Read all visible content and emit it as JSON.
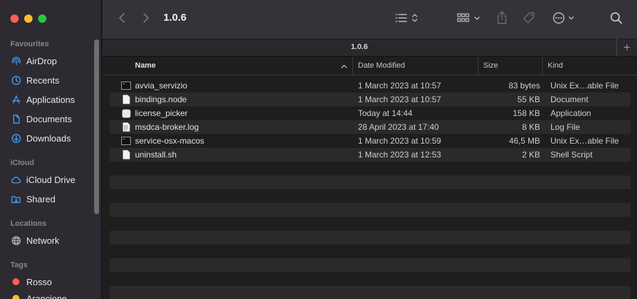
{
  "window": {
    "title": "1.0.6",
    "tab_title": "1.0.6",
    "tab_add_label": "+"
  },
  "sidebar": {
    "sections": {
      "favourites": "Favourites",
      "icloud": "iCloud",
      "locations": "Locations",
      "tags": "Tags"
    },
    "favourites": [
      {
        "label": "AirDrop",
        "icon": "airdrop-icon"
      },
      {
        "label": "Recents",
        "icon": "clock-icon"
      },
      {
        "label": "Applications",
        "icon": "applications-icon"
      },
      {
        "label": "Documents",
        "icon": "document-icon"
      },
      {
        "label": "Downloads",
        "icon": "download-icon"
      }
    ],
    "icloud": [
      {
        "label": "iCloud Drive",
        "icon": "cloud-icon"
      },
      {
        "label": "Shared",
        "icon": "shared-folder-icon"
      }
    ],
    "locations": [
      {
        "label": "Network",
        "icon": "globe-icon"
      }
    ],
    "tags": [
      {
        "label": "Rosso",
        "color": "#fe5f57"
      },
      {
        "label": "Arancione",
        "color": "#febc2e"
      }
    ]
  },
  "list": {
    "columns": {
      "name": "Name",
      "date": "Date Modified",
      "size": "Size",
      "kind": "Kind"
    },
    "files": [
      {
        "name": "avvia_servizio",
        "date": "1 March 2023 at 10:57",
        "size": "83 bytes",
        "kind": "Unix Ex…able File",
        "icon": "exec"
      },
      {
        "name": "bindings.node",
        "date": "1 March 2023 at 10:57",
        "size": "55 KB",
        "kind": "Document",
        "icon": "doc"
      },
      {
        "name": "license_picker",
        "date": "Today at 14:44",
        "size": "158 KB",
        "kind": "Application",
        "icon": "app"
      },
      {
        "name": "msdca-broker.log",
        "date": "28 April 2023 at 17:40",
        "size": "8 KB",
        "kind": "Log File",
        "icon": "log"
      },
      {
        "name": "service-osx-macos",
        "date": "1 March 2023 at 10:59",
        "size": "46,5 MB",
        "kind": "Unix Ex…able File",
        "icon": "exec"
      },
      {
        "name": "uninstall.sh",
        "date": "1 March 2023 at 12:53",
        "size": "2 KB",
        "kind": "Shell Script",
        "icon": "doc"
      }
    ]
  },
  "colors": {
    "accent": "#4a9ff5",
    "tag_red": "#fe5f57",
    "tag_orange": "#febc2e"
  }
}
